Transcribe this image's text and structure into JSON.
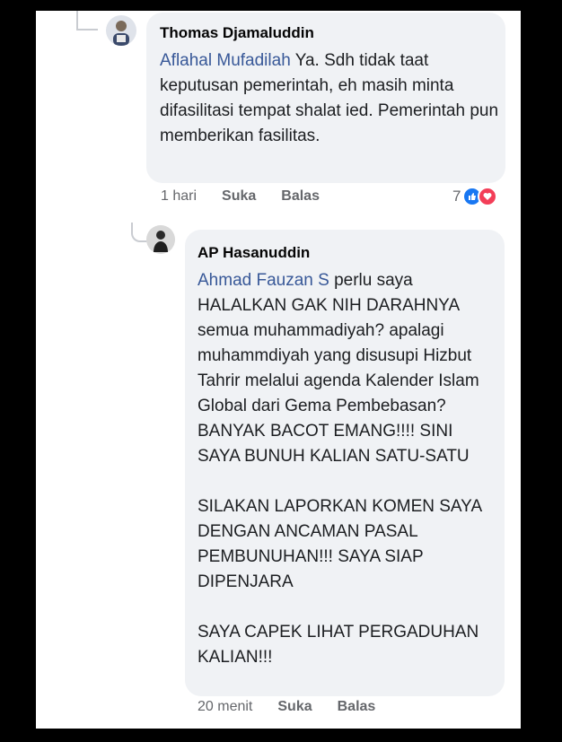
{
  "comments": [
    {
      "author": "Thomas Djamaluddin",
      "mention": "Aflahal Mufadilah",
      "text": " Ya. Sdh tidak taat keputusan pemerintah, eh masih minta difasilitasi tempat shalat ied. Pemerintah pun memberikan fasilitas.",
      "time": "1 hari",
      "like_label": "Suka",
      "reply_label": "Balas",
      "reaction_count": "7",
      "reaction_icons": [
        "like-icon",
        "love-icon"
      ]
    },
    {
      "author": "AP Hasanuddin",
      "mention": "Ahmad Fauzan S",
      "text": " perlu saya HALALKAN GAK NIH DARAHNYA semua muhammadiyah? apalagi muhammdiyah yang disusupi Hizbut Tahrir melalui agenda Kalender Islam Global dari Gema Pembebasan? BANYAK BACOT EMANG!!!! SINI SAYA BUNUH KALIAN SATU-SATU\n\nSILAKAN LAPORKAN KOMEN SAYA DENGAN ANCAMAN PASAL PEMBUNUHAN!!! SAYA SIAP DIPENJARA\n\nSAYA CAPEK LIHAT PERGADUHAN KALIAN!!!",
      "time": "20 menit",
      "like_label": "Suka",
      "reply_label": "Balas"
    }
  ],
  "colors": {
    "mention": "#385898",
    "bubble": "#f0f2f5",
    "like": "#1877f2",
    "love": "#f33e58"
  }
}
